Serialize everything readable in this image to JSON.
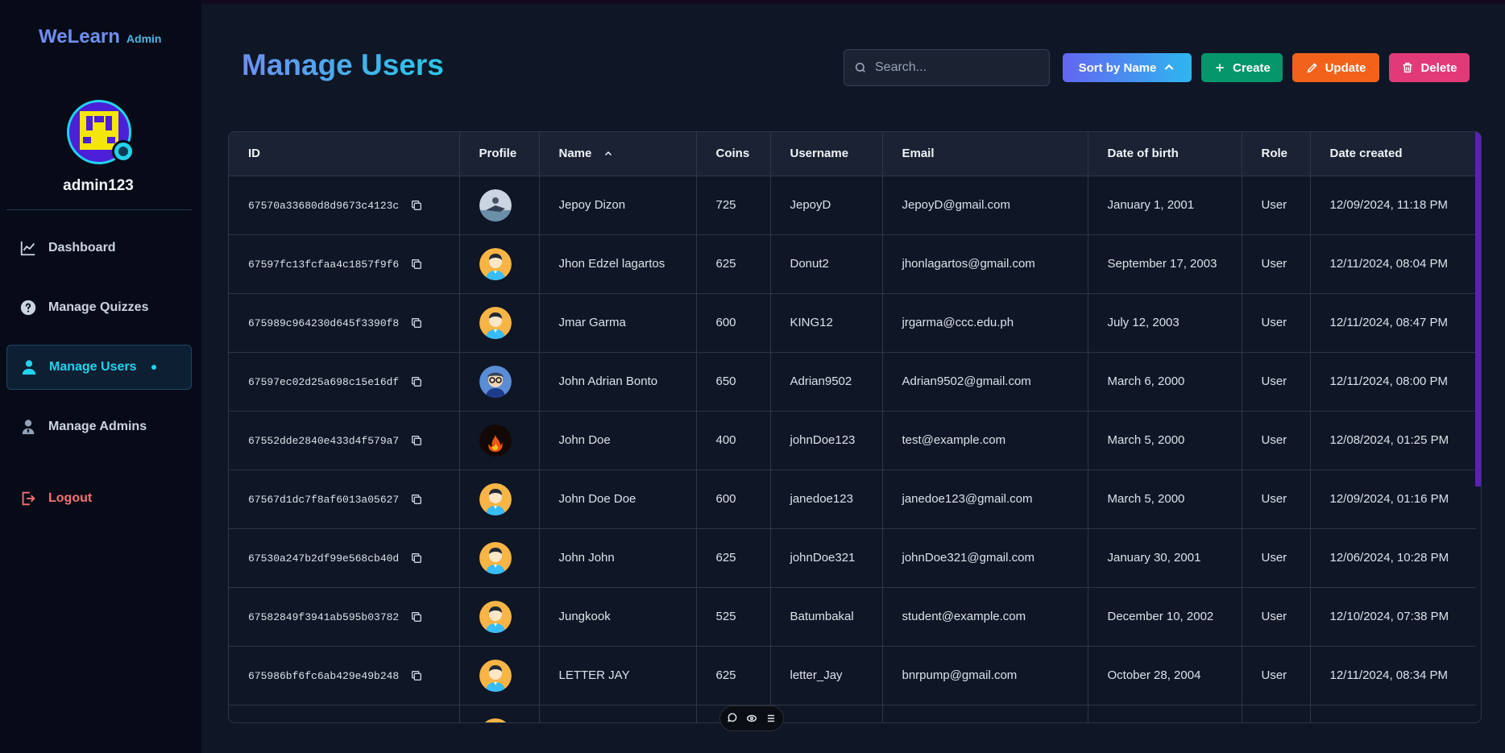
{
  "app": {
    "brand": "WeLearn",
    "brand_tag": "Admin"
  },
  "profile": {
    "username": "admin123"
  },
  "nav": {
    "items": [
      {
        "label": "Dashboard",
        "icon": "chart-line-icon"
      },
      {
        "label": "Manage Quizzes",
        "icon": "question-circle-icon"
      },
      {
        "label": "Manage Users",
        "icon": "user-icon",
        "active": true
      },
      {
        "label": "Manage Admins",
        "icon": "user-tie-icon"
      }
    ],
    "logout": "Logout"
  },
  "page": {
    "title": "Manage Users"
  },
  "toolbar": {
    "search_placeholder": "Search...",
    "sort_label": "Sort by Name",
    "create_label": "Create",
    "update_label": "Update",
    "delete_label": "Delete"
  },
  "colors": {
    "accent": "#22d3ee",
    "create": "#059669",
    "update": "#f2621a",
    "delete": "#e23a78",
    "sort_from": "#6366f1",
    "sort_to": "#2fb6f0"
  },
  "table": {
    "columns": [
      "ID",
      "Profile",
      "Name",
      "Coins",
      "Username",
      "Email",
      "Date of birth",
      "Role",
      "Date created"
    ],
    "rows": [
      {
        "id": "67570a33680d8d9673c4123c",
        "avatar": "photo-jetski",
        "name": "Jepoy Dizon",
        "coins": "725",
        "username": "JepoyD",
        "email": "JepoyD@gmail.com",
        "dob": "January 1, 2001",
        "role": "User",
        "created": "12/09/2024, 11:18 PM"
      },
      {
        "id": "67597fc13fcfaa4c1857f9f6",
        "avatar": "default",
        "name": "Jhon Edzel lagartos",
        "coins": "625",
        "username": "Donut2",
        "email": "jhonlagartos@gmail.com",
        "dob": "September 17, 2003",
        "role": "User",
        "created": "12/11/2024, 08:04 PM"
      },
      {
        "id": "675989c964230d645f3390f8",
        "avatar": "default",
        "name": "Jmar Garma",
        "coins": "600",
        "username": "KING12",
        "email": "jrgarma@ccc.edu.ph",
        "dob": "July 12, 2003",
        "role": "User",
        "created": "12/11/2024, 08:47 PM"
      },
      {
        "id": "67597ec02d25a698c15e16df",
        "avatar": "cartoon-glasses",
        "name": "John Adrian Bonto",
        "coins": "650",
        "username": "Adrian9502",
        "email": "Adrian9502@gmail.com",
        "dob": "March 6, 2000",
        "role": "User",
        "created": "12/11/2024, 08:00 PM"
      },
      {
        "id": "67552dde2840e433d4f579a7",
        "avatar": "fire",
        "name": "John Doe",
        "coins": "400",
        "username": "johnDoe123",
        "email": "test@example.com",
        "dob": "March 5, 2000",
        "role": "User",
        "created": "12/08/2024, 01:25 PM"
      },
      {
        "id": "67567d1dc7f8af6013a05627",
        "avatar": "default",
        "name": "John Doe Doe",
        "coins": "600",
        "username": "janedoe123",
        "email": "janedoe123@gmail.com",
        "dob": "March 5, 2000",
        "role": "User",
        "created": "12/09/2024, 01:16 PM"
      },
      {
        "id": "67530a247b2df99e568cb40d",
        "avatar": "default",
        "name": "John John",
        "coins": "625",
        "username": "johnDoe321",
        "email": "johnDoe321@gmail.com",
        "dob": "January 30, 2001",
        "role": "User",
        "created": "12/06/2024, 10:28 PM"
      },
      {
        "id": "67582849f3941ab595b03782",
        "avatar": "default",
        "name": "Jungkook",
        "coins": "525",
        "username": "Batumbakal",
        "email": "student@example.com",
        "dob": "December 10, 2002",
        "role": "User",
        "created": "12/10/2024, 07:38 PM"
      },
      {
        "id": "675986bf6fc6ab429e49b248",
        "avatar": "default",
        "name": "LETTER JAY",
        "coins": "625",
        "username": "letter_Jay",
        "email": "bnrpump@gmail.com",
        "dob": "October 28, 2004",
        "role": "User",
        "created": "12/11/2024, 08:34 PM"
      },
      {
        "id": "",
        "avatar": "default",
        "name": "",
        "coins": "",
        "username": "",
        "email": "",
        "dob": "",
        "role": "",
        "created": ""
      }
    ]
  }
}
